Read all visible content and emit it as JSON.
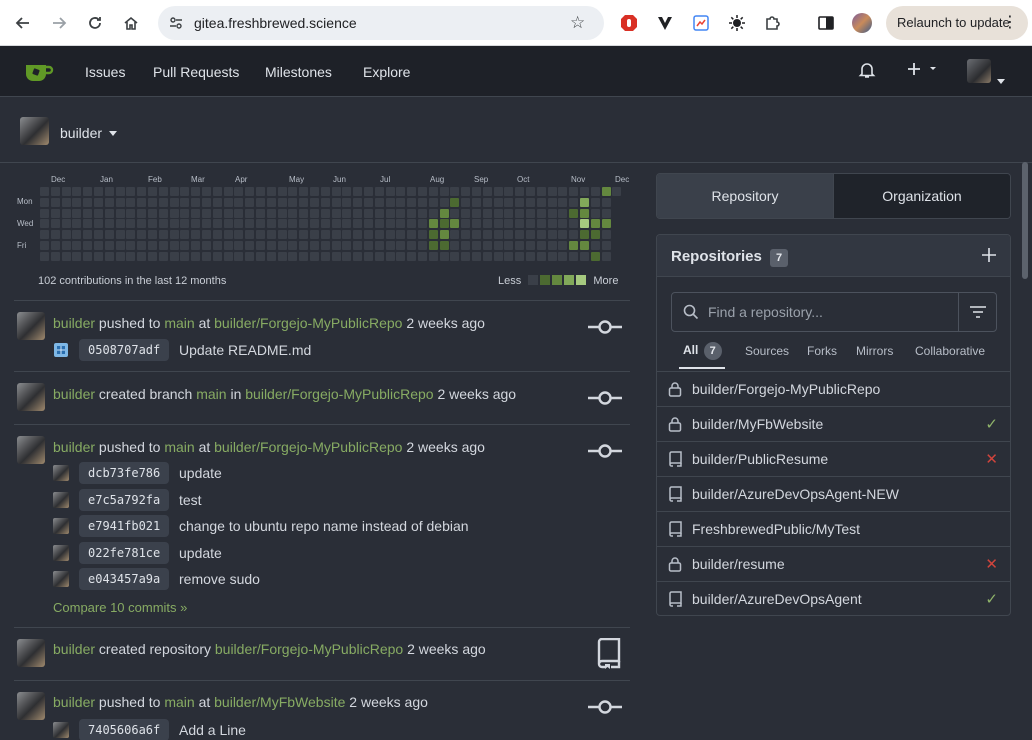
{
  "browser": {
    "url": "gitea.freshbrewed.science",
    "relaunch_label": "Relaunch to update"
  },
  "header": {
    "menu": [
      "Issues",
      "Pull Requests",
      "Milestones",
      "Explore"
    ]
  },
  "context": {
    "user": "builder"
  },
  "heatmap": {
    "months": [
      "Dec",
      "Jan",
      "Feb",
      "Mar",
      "Apr",
      "May",
      "Jun",
      "Jul",
      "Aug",
      "Sep",
      "Oct",
      "Nov",
      "Dec"
    ],
    "weekdays": [
      "Mon",
      "Wed",
      "Fri"
    ],
    "summary": "102 contributions in the last 12 months",
    "legend_less": "Less",
    "legend_more": "More",
    "colors": [
      "#3a3f48",
      "#4c6a31",
      "#64883f",
      "#82a95a",
      "#a6c97f"
    ]
  },
  "feed": [
    {
      "actor": "builder",
      "verb": "pushed to",
      "branch": "main",
      "prep": "at",
      "repo": "builder/Forgejo-MyPublicRepo",
      "time": "2 weeks ago",
      "commits": [
        {
          "sha": "0508707adf",
          "message": "Update README.md"
        }
      ]
    },
    {
      "actor": "builder",
      "verb": "created branch",
      "branch": "main",
      "prep": "in",
      "repo": "builder/Forgejo-MyPublicRepo",
      "time": "2 weeks ago"
    },
    {
      "actor": "builder",
      "verb": "pushed to",
      "branch": "main",
      "prep": "at",
      "repo": "builder/Forgejo-MyPublicRepo",
      "time": "2 weeks ago",
      "commits": [
        {
          "sha": "dcb73fe786",
          "message": "update"
        },
        {
          "sha": "e7c5a792fa",
          "message": "test"
        },
        {
          "sha": "e7941fb021",
          "message": "change to ubuntu repo name instead of debian"
        },
        {
          "sha": "022fe781ce",
          "message": "update"
        },
        {
          "sha": "e043457a9a",
          "message": "remove sudo"
        }
      ],
      "compare": "Compare 10 commits »"
    },
    {
      "actor": "builder",
      "verb": "created repository",
      "repo": "builder/Forgejo-MyPublicRepo",
      "time": "2 weeks ago"
    },
    {
      "actor": "builder",
      "verb": "pushed to",
      "branch": "main",
      "prep": "at",
      "repo": "builder/MyFbWebsite",
      "time": "2 weeks ago",
      "commits": [
        {
          "sha": "7405606a6f",
          "message": "Add a Line"
        }
      ]
    }
  ],
  "panel": {
    "tabs": [
      "Repository",
      "Organization"
    ],
    "title": "Repositories",
    "count": "7",
    "search_placeholder": "Find a repository...",
    "filters": {
      "all": "All",
      "all_count": "7",
      "sources": "Sources",
      "forks": "Forks",
      "mirrors": "Mirrors",
      "collaborative": "Collaborative"
    },
    "repos": [
      {
        "name": "builder/Forgejo-MyPublicRepo",
        "icon": "lock-icon",
        "status": ""
      },
      {
        "name": "builder/MyFbWebsite",
        "icon": "lock-icon",
        "status": "success"
      },
      {
        "name": "builder/PublicResume",
        "icon": "repo-icon",
        "status": "failure"
      },
      {
        "name": "builder/AzureDevOpsAgent-NEW",
        "icon": "repo-icon",
        "status": ""
      },
      {
        "name": "FreshbrewedPublic/MyTest",
        "icon": "repo-icon",
        "status": ""
      },
      {
        "name": "builder/resume",
        "icon": "lock-icon",
        "status": "failure"
      },
      {
        "name": "builder/AzureDevOpsAgent",
        "icon": "repo-icon",
        "status": "success"
      }
    ],
    "status_colors": {
      "success": "#8fb36a",
      "failure": "#d0443c"
    }
  }
}
